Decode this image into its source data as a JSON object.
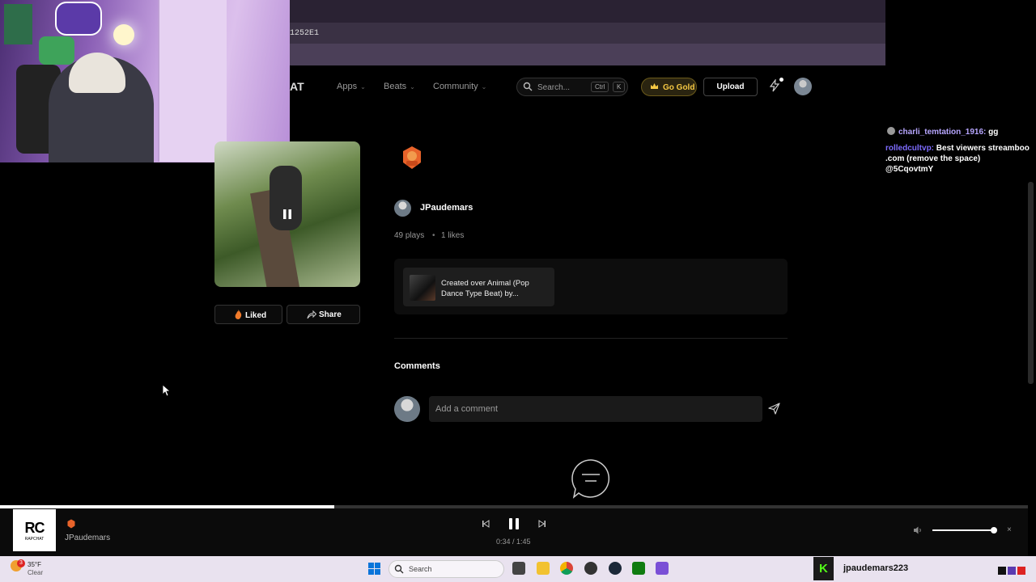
{
  "browser": {
    "url_fragment": "1252E1"
  },
  "nav": {
    "logo_fragment": "AT",
    "items": [
      {
        "label": "Apps"
      },
      {
        "label": "Beats"
      },
      {
        "label": "Community"
      }
    ],
    "search_placeholder": "Search...",
    "search_kbd_1": "Ctrl",
    "search_kbd_2": "K",
    "gold_label": "Go Gold",
    "upload_label": "Upload"
  },
  "track": {
    "artist": "JPaudemars",
    "plays": "49 plays",
    "likes": "1 likes",
    "separator": "•",
    "liked_label": "Liked",
    "share_label": "Share",
    "beat_title": "Created over Animal (Pop Dance Type Beat) by..."
  },
  "comments": {
    "heading": "Comments",
    "placeholder": "Add a comment"
  },
  "chat": {
    "lines": [
      {
        "user": "charli_temtation_1916:",
        "msg": "gg"
      },
      {
        "user": "rolledcultvp:",
        "msg": "Best viewers streamboo .com (remove the space) @5CqovtmY"
      }
    ]
  },
  "player": {
    "logo": "RC",
    "logo_sub": "RAPCHAT",
    "artist": "JPaudemars",
    "time": "0:34 / 1:45",
    "progress_fraction": 0.325,
    "volume_fraction": 0.95,
    "close": "×"
  },
  "taskbar": {
    "temp": "35°F",
    "condition": "Clear",
    "weather_badge": "3",
    "search_label": "Search",
    "kick_user": "jpaudemars223"
  },
  "colors": {
    "gold": "#f5c843",
    "accent_green": "#53fc18",
    "chat_user_1": "#b7a6ff",
    "chat_user_2": "#7d6bff"
  }
}
